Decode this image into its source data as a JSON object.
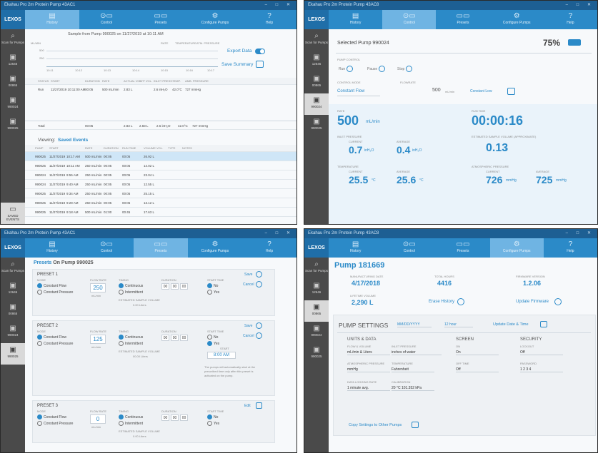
{
  "p1": {
    "title": "Ekahau Pro 2m Protein Pump 43AC1",
    "logo": "LEXOS",
    "nav": [
      "History",
      "Control",
      "Presets",
      "Configure Pumps",
      "Help"
    ],
    "side": [
      "Scan for Pumps",
      "12646",
      "00865",
      "990024",
      "990025"
    ],
    "sidebottom": "SAVED EVENTS",
    "sample_title": "Sample from Pump 990025 on 11/27/2019 at 10:11 AM",
    "chart_toplbl": "mL/min",
    "chart_legend": [
      "Rate",
      "Temperature",
      "Atm. Pressure"
    ],
    "yt": [
      "500",
      "250"
    ],
    "xt": [
      "10:11",
      "10:12",
      "10:13",
      "10:14",
      "10:15",
      "10:16",
      "10:17"
    ],
    "export": "Export Data",
    "save": "Save Summary",
    "table_head": [
      "Status",
      "Start",
      "Duration",
      "Rate",
      "Actual Vol.",
      "STP Vol.",
      "Inlet Press.",
      "Temp.",
      "Amb. Pressure"
    ],
    "table_row": [
      "Run",
      "11/27/2019 10:11:00 AM",
      "00:05",
      "500 mL/min",
      "2.83 L",
      "",
      "2.6 inH₂O",
      "42.0°C",
      "727 mmHg"
    ],
    "total_label": "Total",
    "total_row": [
      "00:05",
      "2.83 L",
      "2.83 L",
      "2.6 inH₂O",
      "42.0°C",
      "727 mmHg"
    ],
    "viewing": "Viewing:",
    "saved": "Saved Events",
    "ev_head": [
      "Pump",
      "Start",
      "Rate",
      "Duration",
      "Run Time",
      "Volume Vol.",
      "Type",
      "Notes"
    ],
    "events": [
      [
        "990025",
        "11/27/2019",
        "10:17 AM",
        "500 mL/min",
        "00:05",
        "00:05",
        "26.92 L"
      ],
      [
        "990025",
        "11/27/2019",
        "10:11 AM",
        "250 mL/min",
        "00:05",
        "00:05",
        "14.02 L"
      ],
      [
        "990024",
        "11/27/2019",
        "9:55 AM",
        "250 mL/min",
        "00:05",
        "00:05",
        "23.04 L"
      ],
      [
        "990024",
        "11/27/2019",
        "9:40 AM",
        "250 mL/min",
        "00:05",
        "00:05",
        "12.55 L"
      ],
      [
        "990025",
        "11/27/2019",
        "9:34 AM",
        "250 mL/min",
        "00:05",
        "00:05",
        "25.15 L"
      ],
      [
        "990025",
        "11/27/2019",
        "9:29 AM",
        "250 mL/min",
        "00:05",
        "00:05",
        "13.12 L"
      ],
      [
        "990025",
        "11/27/2019",
        "9:18 AM",
        "500 mL/min",
        "01:00",
        "00:45",
        "17.63 L"
      ]
    ]
  },
  "p2": {
    "title": "Ekahau Pro 2m Protein Pump 43AC8",
    "selected": "Selected Pump 990024",
    "battery": "75%",
    "pump_control": "PUMP CONTROL",
    "controls": [
      "Run",
      "Pause",
      "Stop"
    ],
    "control_mode": "CONTROL MODE",
    "flowrate_lbl": "FLOWRATE",
    "mode_val": "Constant Flow",
    "flow_val": "500",
    "flow_unit": "mL/min",
    "flow_btn": "Constant Low",
    "rate_lbl": "RATE",
    "rate_val": "500",
    "rate_unit": "mL/min",
    "runtime_lbl": "RUN TIME",
    "runtime": "00:00:16",
    "inlet_lbl": "INLET PRESSURE",
    "current_lbl": "CURRENT",
    "average_lbl": "AVERAGE",
    "inlet_cur": "0.7",
    "inlet_avg": "0.4",
    "inlet_unit": "inH₂O",
    "vol_lbl": "ESTIMATED SAMPLE VOLUME (APPROXIMATE)",
    "vol": "0.13",
    "vol_unit": "L",
    "temp_lbl": "TEMPERATURE",
    "temp_cur": "25.5",
    "temp_avg": "25.6",
    "temp_unit": "°C",
    "atm_lbl": "ATMOSPHERIC PRESSURE",
    "atm_cur": "726",
    "atm_avg": "725",
    "atm_unit": "mmHg"
  },
  "p3": {
    "title": "Ekahau Pro 2m Protein Pump 43AC1",
    "heading_a": "Presets",
    "heading_b": "On Pump 990025",
    "labels": {
      "mode": "MODE",
      "flow": "FLOW RATE",
      "timing": "TIMING",
      "duration": "DURATION",
      "start": "START TIME"
    },
    "modes": [
      "Constant Flow",
      "Constant Pressure"
    ],
    "timings": [
      "Continuous",
      "Intermittent"
    ],
    "starts": [
      "No",
      "Yes"
    ],
    "save": "Save",
    "cancel": "Cancel",
    "edit": "Edit",
    "est": "ESTIMATED SAMPLE VOLUME",
    "presets": [
      {
        "name": "PRESET 1",
        "flow": "250",
        "unit": "mL/min",
        "dur": [
          "00",
          "00",
          "00"
        ],
        "vol": "0.00 Liters"
      },
      {
        "name": "PRESET 2",
        "flow": "125",
        "unit": "mL/min",
        "dur": [
          "00",
          "00",
          "00"
        ],
        "vol": "00.00 Liters",
        "start_lbl": "START",
        "start_time": "8:00 AM",
        "note": "The pumps will automatically start at the prescribed time only after this preset is activated on the pump."
      },
      {
        "name": "PRESET 3",
        "flow": "0",
        "unit": "mL/min",
        "dur": [
          "00",
          "00",
          "00"
        ],
        "vol": "0.00 Liters"
      }
    ]
  },
  "p4": {
    "title": "Ekahau Pro 2m Protein Pump 43AC8",
    "pump": "Pump 181669",
    "mfg_lbl": "MANUFACTURING DATE",
    "mfg": "4/17/2018",
    "hours_lbl": "TOTAL HOURS",
    "hours": "4416",
    "fw_lbl": "FIRMWARE VERSION",
    "fw": "1.2.06",
    "vol_lbl": "LIFETIME VOLUME",
    "vol": "2,290 L",
    "erase": "Erase History",
    "update_fw": "Update Firmware",
    "settings": "PUMP SETTINGS",
    "date_fmt": "MM/DD/YYYY",
    "hour_fmt": "12 hour",
    "update_dt": "Update Date & Time",
    "units_h": "UNITS & DATA",
    "screen_h": "SCREEN",
    "security_h": "SECURITY",
    "fields": [
      {
        "l": "FLOW & VOLUME",
        "v": "mL/min & Liters"
      },
      {
        "l": "INLET PRESSURE",
        "v": "inches of water"
      },
      {
        "l": "ON",
        "v": "On"
      },
      {
        "l": "LOCKOUT",
        "v": "Off"
      },
      {
        "l": "ATMOSPHERIC PRESSURE",
        "v": "mmHg"
      },
      {
        "l": "TEMPERATURE",
        "v": "Fahrenheit"
      },
      {
        "l": "OFF TIME",
        "v": "Off"
      },
      {
        "l": "PASSWORD",
        "v": "1 2 3 4"
      },
      {
        "l": "DATA LOGGING RATE",
        "v": "1 minute avg."
      },
      {
        "l": "CALIBRATION",
        "v": "20 °C 101.352 kPa"
      }
    ],
    "copy": "Copy Settings to Other Pumps"
  }
}
